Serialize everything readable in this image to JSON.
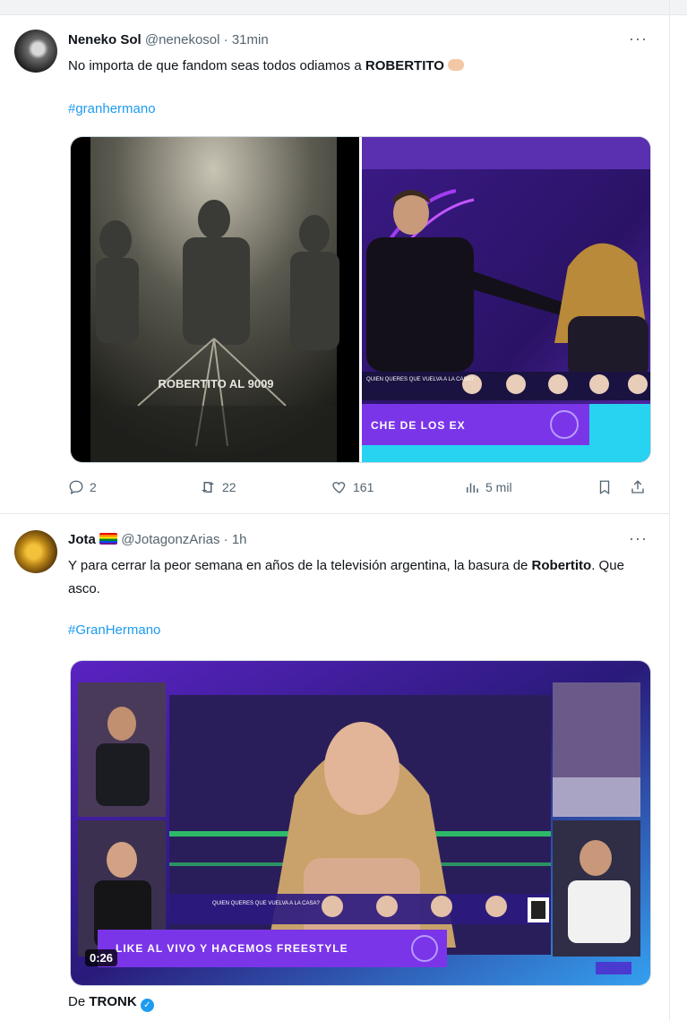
{
  "tweets": [
    {
      "name": "Neneko Sol",
      "handle": "@nenekosol",
      "sep": "·",
      "time": "31min",
      "more": "···",
      "text_before": "No importa de que fandom seas todos odiamos a ",
      "text_bold": "ROBERTITO",
      "hashtag": "#granhermano",
      "media_left_caption": "ROBERTITO AL 9009",
      "media_right_ticker": "CHE DE LOS EX",
      "media_right_banner": "QUIEN QUERES QUE\nVUELVA A LA CASA?",
      "replies": "2",
      "retweets": "22",
      "likes": "161",
      "views": "5 mil"
    },
    {
      "name": "Jota",
      "handle": "@JotagonzArias",
      "sep": "·",
      "time": "1h",
      "more": "···",
      "text_before": "Y para cerrar la peor semana en años de la televisión argentina, la basura de ",
      "text_bold": "Robertito",
      "text_after": ". Que asco.",
      "hashtag": "#GranHermano",
      "media_ticker": "LIKE AL VIVO Y HACEMOS FREESTYLE",
      "media_banner": "QUIEN QUERES QUE\nVUELVA A LA CASA?",
      "video_time": "0:26",
      "via_label": "De ",
      "via_name": "TRONK"
    }
  ],
  "colors": {
    "link": "#1d9bf0",
    "secondary_text": "#536471",
    "divider": "#e6e9ec"
  },
  "icons": [
    "more-icon",
    "reply-icon",
    "retweet-icon",
    "like-icon",
    "views-icon",
    "bookmark-icon",
    "share-icon",
    "verified-icon",
    "rainbow-flag-icon",
    "hand-emoji-icon"
  ]
}
